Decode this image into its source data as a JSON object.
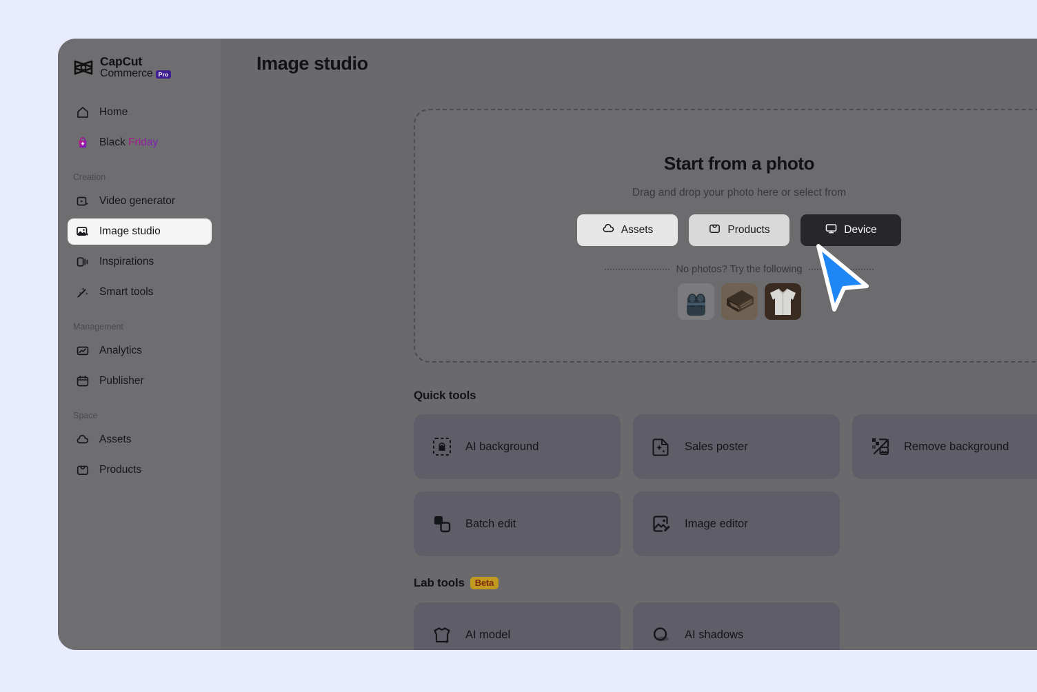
{
  "brand": {
    "line1": "CapCut",
    "line2": "Commerce",
    "badge": "Pro",
    "logo_icon": "capcut-logo-icon"
  },
  "sidebar": {
    "top_items": [
      {
        "label": "Home",
        "icon": "home-icon",
        "active": false
      },
      {
        "label_a": "Black ",
        "label_b": "Friday",
        "icon": "gift-bag-icon",
        "active": false
      }
    ],
    "groups": [
      {
        "label": "Creation",
        "items": [
          {
            "label": "Video generator",
            "icon": "video-generator-icon",
            "active": false
          },
          {
            "label": "Image studio",
            "icon": "image-studio-icon",
            "active": true
          },
          {
            "label": "Inspirations",
            "icon": "inspirations-icon",
            "active": false
          },
          {
            "label": "Smart tools",
            "icon": "magic-wand-icon",
            "active": false
          }
        ]
      },
      {
        "label": "Management",
        "items": [
          {
            "label": "Analytics",
            "icon": "analytics-icon",
            "active": false
          },
          {
            "label": "Publisher",
            "icon": "calendar-icon",
            "active": false
          }
        ]
      },
      {
        "label": "Space",
        "items": [
          {
            "label": "Assets",
            "icon": "cloud-icon",
            "active": false
          },
          {
            "label": "Products",
            "icon": "bag-icon",
            "active": false
          }
        ]
      }
    ]
  },
  "header": {
    "title": "Image studio"
  },
  "upload": {
    "title": "Start from a photo",
    "subtitle": "Drag and drop your photo here or select from",
    "buttons": [
      {
        "label": "Assets",
        "icon": "cloud-icon",
        "style": "light"
      },
      {
        "label": "Products",
        "icon": "bag-icon",
        "style": "light2"
      },
      {
        "label": "Device",
        "icon": "monitor-icon",
        "style": "dark"
      }
    ],
    "no_photos_text": "No photos? Try the following",
    "thumbnails": [
      {
        "name": "earbuds-thumbnail"
      },
      {
        "name": "makeup-palette-thumbnail"
      },
      {
        "name": "white-shirt-thumbnail"
      }
    ],
    "preview_image": "sample-photo-preview"
  },
  "quick_tools": {
    "heading": "Quick tools",
    "items": [
      {
        "label": "AI background",
        "icon": "ai-background-icon"
      },
      {
        "label": "Sales poster",
        "icon": "sales-poster-icon"
      },
      {
        "label": "Remove background",
        "icon": "remove-background-icon"
      },
      {
        "label": "Batch edit",
        "icon": "batch-edit-icon"
      },
      {
        "label": "Image editor",
        "icon": "image-editor-icon"
      }
    ]
  },
  "lab_tools": {
    "heading": "Lab tools",
    "badge": "Beta",
    "items": [
      {
        "label": "AI model",
        "icon": "ai-model-icon"
      },
      {
        "label": "AI shadows",
        "icon": "ai-shadows-icon"
      }
    ]
  },
  "cursor": {
    "name": "mouse-pointer",
    "color": "#1f86f5"
  },
  "colors": {
    "page_background": "#e9ecfc",
    "window_background": "#6a6a6c",
    "sidebar_background": "#6e6e70",
    "card_background": "#5f5d67",
    "active_nav": "#f5f5f6",
    "primary_button": "#27272b",
    "beta_badge": "#c09a1e",
    "pro_badge": "#3f1f8f"
  }
}
